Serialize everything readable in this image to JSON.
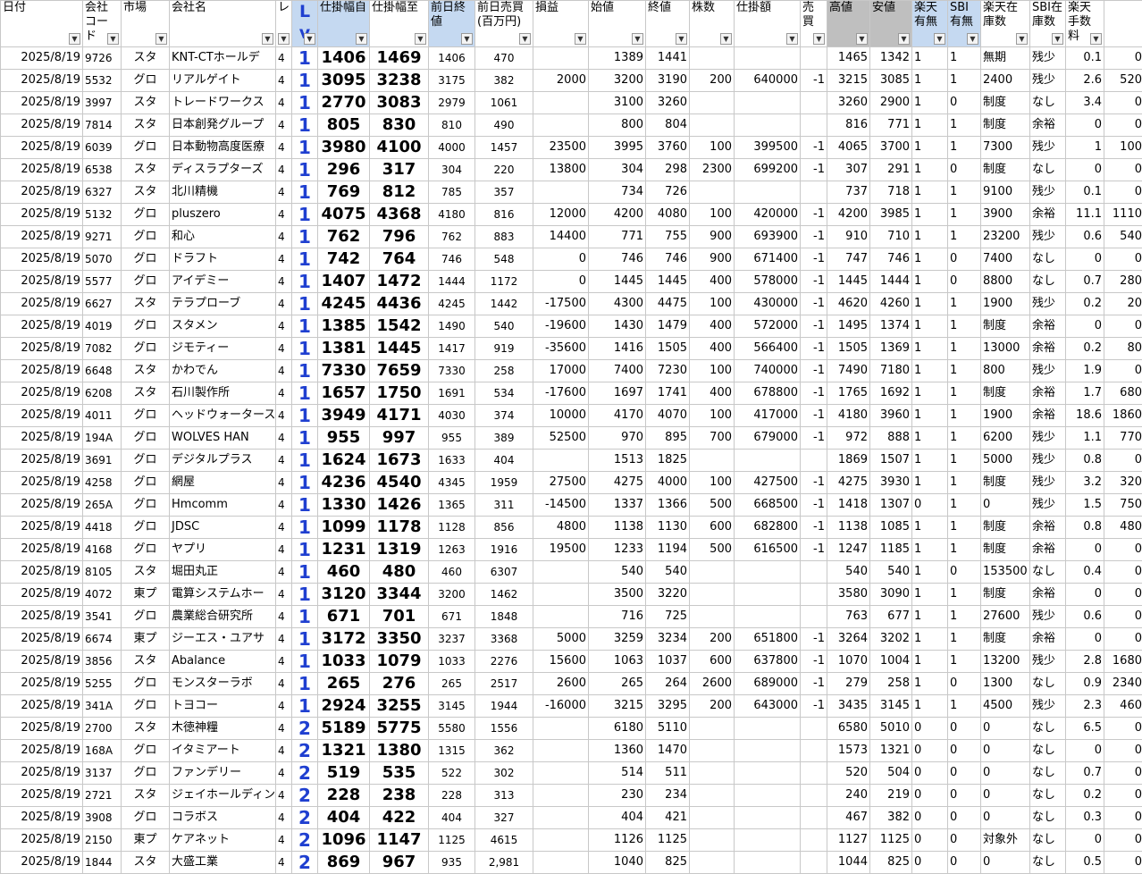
{
  "columns": [
    {
      "key": "date",
      "label": "日付",
      "cls": ""
    },
    {
      "key": "code",
      "label": "会社コード",
      "cls": ""
    },
    {
      "key": "market",
      "label": "市場",
      "cls": ""
    },
    {
      "key": "name",
      "label": "会社名",
      "cls": ""
    },
    {
      "key": "level",
      "label": "レ",
      "cls": ""
    },
    {
      "key": "lv",
      "label": "Lv",
      "cls": "blue lv"
    },
    {
      "key": "from",
      "label": "仕掛幅自",
      "cls": "blue"
    },
    {
      "key": "to",
      "label": "仕掛幅至",
      "cls": ""
    },
    {
      "key": "prev",
      "label": "前日終値",
      "cls": "blue"
    },
    {
      "key": "vol",
      "label": "前日売買(百万円)",
      "cls": ""
    },
    {
      "key": "pl",
      "label": "損益",
      "cls": ""
    },
    {
      "key": "open",
      "label": "始値",
      "cls": ""
    },
    {
      "key": "close",
      "label": "終値",
      "cls": ""
    },
    {
      "key": "shares",
      "label": "株数",
      "cls": ""
    },
    {
      "key": "amount",
      "label": "仕掛額",
      "cls": ""
    },
    {
      "key": "side",
      "label": "売買",
      "cls": ""
    },
    {
      "key": "high",
      "label": "高値",
      "cls": "gray"
    },
    {
      "key": "low",
      "label": "安値",
      "cls": "gray"
    },
    {
      "key": "rk",
      "label": "楽天有無",
      "cls": "blue"
    },
    {
      "key": "sbi",
      "label": "SBI有無",
      "cls": "blue"
    },
    {
      "key": "rkstock",
      "label": "楽天在庫数",
      "cls": ""
    },
    {
      "key": "sbistock",
      "label": "SBI在庫数",
      "cls": ""
    },
    {
      "key": "fee",
      "label": "楽天手数料",
      "cls": ""
    },
    {
      "key": "fee2",
      "label": "",
      "cls": ""
    }
  ],
  "rows": [
    [
      "2025/8/19",
      "9726",
      "スタ",
      "KNT-CTホールデ",
      "4",
      "1",
      "1406",
      "1469",
      "1406",
      "470",
      "",
      "1389",
      "1441",
      "",
      "",
      "",
      "1465",
      "1342",
      "1",
      "1",
      "無期",
      "残少",
      "0.1",
      "0"
    ],
    [
      "2025/8/19",
      "5532",
      "グロ",
      "リアルゲイト",
      "4",
      "1",
      "3095",
      "3238",
      "3175",
      "382",
      "2000",
      "3200",
      "3190",
      "200",
      "640000",
      "-1",
      "3215",
      "3085",
      "1",
      "1",
      "2400",
      "残少",
      "2.6",
      "520"
    ],
    [
      "2025/8/19",
      "3997",
      "スタ",
      "トレードワークス",
      "4",
      "1",
      "2770",
      "3083",
      "2979",
      "1061",
      "",
      "3100",
      "3260",
      "",
      "",
      "",
      "3260",
      "2900",
      "1",
      "0",
      "制度",
      "なし",
      "3.4",
      "0"
    ],
    [
      "2025/8/19",
      "7814",
      "スタ",
      "日本創発グループ",
      "4",
      "1",
      "805",
      "830",
      "810",
      "490",
      "",
      "800",
      "804",
      "",
      "",
      "",
      "816",
      "771",
      "1",
      "1",
      "制度",
      "余裕",
      "0",
      "0"
    ],
    [
      "2025/8/19",
      "6039",
      "グロ",
      "日本動物高度医療",
      "4",
      "1",
      "3980",
      "4100",
      "4000",
      "1457",
      "23500",
      "3995",
      "3760",
      "100",
      "399500",
      "-1",
      "4065",
      "3700",
      "1",
      "1",
      "7300",
      "残少",
      "1",
      "100"
    ],
    [
      "2025/8/19",
      "6538",
      "スタ",
      "ディスラプターズ",
      "4",
      "1",
      "296",
      "317",
      "304",
      "220",
      "13800",
      "304",
      "298",
      "2300",
      "699200",
      "-1",
      "307",
      "291",
      "1",
      "0",
      "制度",
      "なし",
      "0",
      "0"
    ],
    [
      "2025/8/19",
      "6327",
      "スタ",
      "北川精機",
      "4",
      "1",
      "769",
      "812",
      "785",
      "357",
      "",
      "734",
      "726",
      "",
      "",
      "",
      "737",
      "718",
      "1",
      "1",
      "9100",
      "残少",
      "0.1",
      "0"
    ],
    [
      "2025/8/19",
      "5132",
      "グロ",
      "pluszero",
      "4",
      "1",
      "4075",
      "4368",
      "4180",
      "816",
      "12000",
      "4200",
      "4080",
      "100",
      "420000",
      "-1",
      "4200",
      "3985",
      "1",
      "1",
      "3900",
      "余裕",
      "11.1",
      "1110"
    ],
    [
      "2025/8/19",
      "9271",
      "グロ",
      "和心",
      "4",
      "1",
      "762",
      "796",
      "762",
      "883",
      "14400",
      "771",
      "755",
      "900",
      "693900",
      "-1",
      "910",
      "710",
      "1",
      "1",
      "23200",
      "残少",
      "0.6",
      "540"
    ],
    [
      "2025/8/19",
      "5070",
      "グロ",
      "ドラフト",
      "4",
      "1",
      "742",
      "764",
      "746",
      "548",
      "0",
      "746",
      "746",
      "900",
      "671400",
      "-1",
      "747",
      "746",
      "1",
      "0",
      "7400",
      "なし",
      "0",
      "0"
    ],
    [
      "2025/8/19",
      "5577",
      "グロ",
      "アイデミー",
      "4",
      "1",
      "1407",
      "1472",
      "1444",
      "1172",
      "0",
      "1445",
      "1445",
      "400",
      "578000",
      "-1",
      "1445",
      "1444",
      "1",
      "0",
      "8800",
      "なし",
      "0.7",
      "280"
    ],
    [
      "2025/8/19",
      "6627",
      "スタ",
      "テラプローブ",
      "4",
      "1",
      "4245",
      "4436",
      "4245",
      "1442",
      "-17500",
      "4300",
      "4475",
      "100",
      "430000",
      "-1",
      "4620",
      "4260",
      "1",
      "1",
      "1900",
      "残少",
      "0.2",
      "20"
    ],
    [
      "2025/8/19",
      "4019",
      "グロ",
      "スタメン",
      "4",
      "1",
      "1385",
      "1542",
      "1490",
      "540",
      "-19600",
      "1430",
      "1479",
      "400",
      "572000",
      "-1",
      "1495",
      "1374",
      "1",
      "1",
      "制度",
      "余裕",
      "0",
      "0"
    ],
    [
      "2025/8/19",
      "7082",
      "グロ",
      "ジモティー",
      "4",
      "1",
      "1381",
      "1445",
      "1417",
      "919",
      "-35600",
      "1416",
      "1505",
      "400",
      "566400",
      "-1",
      "1505",
      "1369",
      "1",
      "1",
      "13000",
      "余裕",
      "0.2",
      "80"
    ],
    [
      "2025/8/19",
      "6648",
      "スタ",
      "かわでん",
      "4",
      "1",
      "7330",
      "7659",
      "7330",
      "258",
      "17000",
      "7400",
      "7230",
      "100",
      "740000",
      "-1",
      "7490",
      "7180",
      "1",
      "1",
      "800",
      "残少",
      "1.9",
      "0"
    ],
    [
      "2025/8/19",
      "6208",
      "スタ",
      "石川製作所",
      "4",
      "1",
      "1657",
      "1750",
      "1691",
      "534",
      "-17600",
      "1697",
      "1741",
      "400",
      "678800",
      "-1",
      "1765",
      "1692",
      "1",
      "1",
      "制度",
      "余裕",
      "1.7",
      "680"
    ],
    [
      "2025/8/19",
      "4011",
      "グロ",
      "ヘッドウォータース",
      "4",
      "1",
      "3949",
      "4171",
      "4030",
      "374",
      "10000",
      "4170",
      "4070",
      "100",
      "417000",
      "-1",
      "4180",
      "3960",
      "1",
      "1",
      "1900",
      "余裕",
      "18.6",
      "1860"
    ],
    [
      "2025/8/19",
      "194A",
      "グロ",
      "WOLVES HAN",
      "4",
      "1",
      "955",
      "997",
      "955",
      "389",
      "52500",
      "970",
      "895",
      "700",
      "679000",
      "-1",
      "972",
      "888",
      "1",
      "1",
      "6200",
      "残少",
      "1.1",
      "770"
    ],
    [
      "2025/8/19",
      "3691",
      "グロ",
      "デジタルプラス",
      "4",
      "1",
      "1624",
      "1673",
      "1633",
      "404",
      "",
      "1513",
      "1825",
      "",
      "",
      "",
      "1869",
      "1507",
      "1",
      "1",
      "5000",
      "残少",
      "0.8",
      "0"
    ],
    [
      "2025/8/19",
      "4258",
      "グロ",
      "網屋",
      "4",
      "1",
      "4236",
      "4540",
      "4345",
      "1959",
      "27500",
      "4275",
      "4000",
      "100",
      "427500",
      "-1",
      "4275",
      "3930",
      "1",
      "1",
      "制度",
      "残少",
      "3.2",
      "320"
    ],
    [
      "2025/8/19",
      "265A",
      "グロ",
      "Hmcomm",
      "4",
      "1",
      "1330",
      "1426",
      "1365",
      "311",
      "-14500",
      "1337",
      "1366",
      "500",
      "668500",
      "-1",
      "1418",
      "1307",
      "0",
      "1",
      "0",
      "残少",
      "1.5",
      "750"
    ],
    [
      "2025/8/19",
      "4418",
      "グロ",
      "JDSC",
      "4",
      "1",
      "1099",
      "1178",
      "1128",
      "856",
      "4800",
      "1138",
      "1130",
      "600",
      "682800",
      "-1",
      "1138",
      "1085",
      "1",
      "1",
      "制度",
      "余裕",
      "0.8",
      "480"
    ],
    [
      "2025/8/19",
      "4168",
      "グロ",
      "ヤプリ",
      "4",
      "1",
      "1231",
      "1319",
      "1263",
      "1916",
      "19500",
      "1233",
      "1194",
      "500",
      "616500",
      "-1",
      "1247",
      "1185",
      "1",
      "1",
      "制度",
      "余裕",
      "0",
      "0"
    ],
    [
      "2025/8/19",
      "8105",
      "スタ",
      "堀田丸正",
      "4",
      "1",
      "460",
      "480",
      "460",
      "6307",
      "",
      "540",
      "540",
      "",
      "",
      "",
      "540",
      "540",
      "1",
      "0",
      "153500",
      "なし",
      "0.4",
      "0"
    ],
    [
      "2025/8/19",
      "4072",
      "東プ",
      "電算システムホー",
      "4",
      "1",
      "3120",
      "3344",
      "3200",
      "1462",
      "",
      "3500",
      "3220",
      "",
      "",
      "",
      "3580",
      "3090",
      "1",
      "1",
      "制度",
      "余裕",
      "0",
      "0"
    ],
    [
      "2025/8/19",
      "3541",
      "グロ",
      "農業総合研究所",
      "4",
      "1",
      "671",
      "701",
      "671",
      "1848",
      "",
      "716",
      "725",
      "",
      "",
      "",
      "763",
      "677",
      "1",
      "1",
      "27600",
      "残少",
      "0.6",
      "0"
    ],
    [
      "2025/8/19",
      "6674",
      "東プ",
      "ジーエス・ユアサ",
      "4",
      "1",
      "3172",
      "3350",
      "3237",
      "3368",
      "5000",
      "3259",
      "3234",
      "200",
      "651800",
      "-1",
      "3264",
      "3202",
      "1",
      "1",
      "制度",
      "余裕",
      "0",
      "0"
    ],
    [
      "2025/8/19",
      "3856",
      "スタ",
      "Abalance",
      "4",
      "1",
      "1033",
      "1079",
      "1033",
      "2276",
      "15600",
      "1063",
      "1037",
      "600",
      "637800",
      "-1",
      "1070",
      "1004",
      "1",
      "1",
      "13200",
      "残少",
      "2.8",
      "1680"
    ],
    [
      "2025/8/19",
      "5255",
      "グロ",
      "モンスターラボ",
      "4",
      "1",
      "265",
      "276",
      "265",
      "2517",
      "2600",
      "265",
      "264",
      "2600",
      "689000",
      "-1",
      "279",
      "258",
      "1",
      "0",
      "1300",
      "なし",
      "0.9",
      "2340"
    ],
    [
      "2025/8/19",
      "341A",
      "グロ",
      "トヨコー",
      "4",
      "1",
      "2924",
      "3255",
      "3145",
      "1944",
      "-16000",
      "3215",
      "3295",
      "200",
      "643000",
      "-1",
      "3435",
      "3145",
      "1",
      "1",
      "4500",
      "残少",
      "2.3",
      "460"
    ],
    [
      "2025/8/19",
      "2700",
      "スタ",
      "木徳神糧",
      "4",
      "2",
      "5189",
      "5775",
      "5580",
      "1556",
      "",
      "6180",
      "5110",
      "",
      "",
      "",
      "6580",
      "5010",
      "0",
      "0",
      "0",
      "なし",
      "6.5",
      "0"
    ],
    [
      "2025/8/19",
      "168A",
      "グロ",
      "イタミアート",
      "4",
      "2",
      "1321",
      "1380",
      "1315",
      "362",
      "",
      "1360",
      "1470",
      "",
      "",
      "",
      "1573",
      "1321",
      "0",
      "0",
      "0",
      "なし",
      "0",
      "0"
    ],
    [
      "2025/8/19",
      "3137",
      "グロ",
      "ファンデリー",
      "4",
      "2",
      "519",
      "535",
      "522",
      "302",
      "",
      "514",
      "511",
      "",
      "",
      "",
      "520",
      "504",
      "0",
      "0",
      "0",
      "なし",
      "0.7",
      "0"
    ],
    [
      "2025/8/19",
      "2721",
      "スタ",
      "ジェイホールディン",
      "4",
      "2",
      "228",
      "238",
      "228",
      "313",
      "",
      "230",
      "234",
      "",
      "",
      "",
      "240",
      "219",
      "0",
      "0",
      "0",
      "なし",
      "0.2",
      "0"
    ],
    [
      "2025/8/19",
      "3908",
      "グロ",
      "コラボス",
      "4",
      "2",
      "404",
      "422",
      "404",
      "327",
      "",
      "404",
      "421",
      "",
      "",
      "",
      "467",
      "382",
      "0",
      "0",
      "0",
      "なし",
      "0.3",
      "0"
    ],
    [
      "2025/8/19",
      "2150",
      "東プ",
      "ケアネット",
      "4",
      "2",
      "1096",
      "1147",
      "1125",
      "4615",
      "",
      "1126",
      "1125",
      "",
      "",
      "",
      "1127",
      "1125",
      "0",
      "0",
      "対象外",
      "なし",
      "0",
      "0"
    ],
    [
      "2025/8/19",
      "1844",
      "スタ",
      "大盛工業",
      "4",
      "2",
      "869",
      "967",
      "935",
      "2,981",
      "",
      "1040",
      "825",
      "",
      "",
      "",
      "1044",
      "825",
      "0",
      "0",
      "0",
      "なし",
      "0.5",
      "0"
    ]
  ]
}
